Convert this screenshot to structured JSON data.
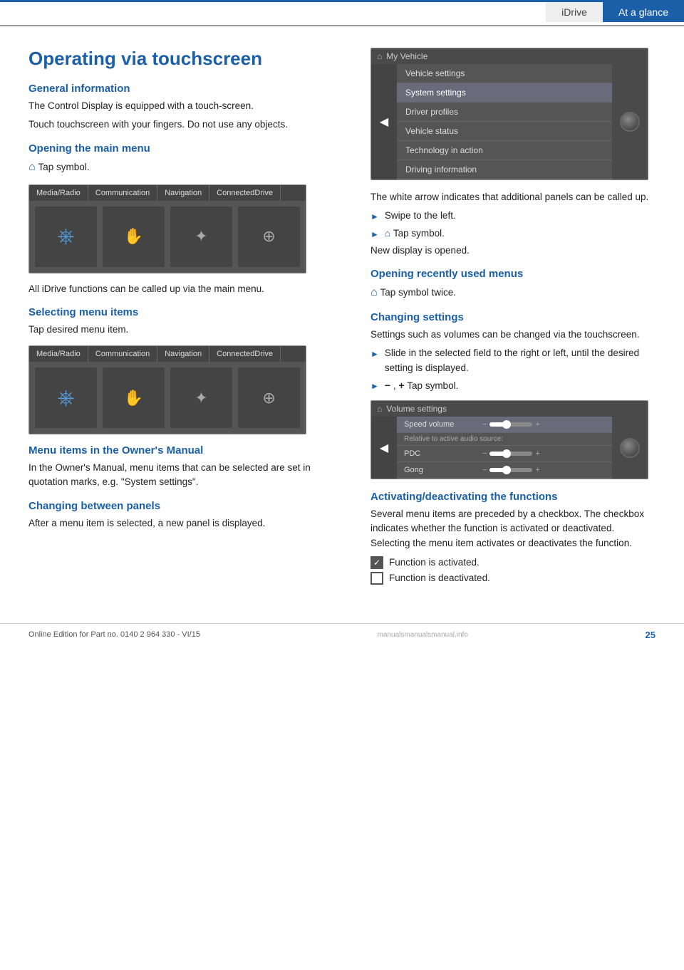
{
  "header": {
    "idrive_label": "iDrive",
    "tab_label": "At a glance"
  },
  "page": {
    "title": "Operating via touchscreen",
    "sections": {
      "general_info": {
        "heading": "General information",
        "para1": "The Control Display is equipped with a touch-screen.",
        "para2": "Touch touchscreen with your fingers. Do not use any objects."
      },
      "opening_main_menu": {
        "heading": "Opening the main menu",
        "text": "Tap symbol."
      },
      "screen1": {
        "menu_items": [
          "Media/Radio",
          "Communication",
          "Navigation",
          "ConnectedDrive"
        ]
      },
      "all_idrive": {
        "text": "All iDrive functions can be called up via the main menu."
      },
      "selecting_menu_items": {
        "heading": "Selecting menu items",
        "text": "Tap desired menu item."
      },
      "screen2": {
        "menu_items": [
          "Media/Radio",
          "Communication",
          "Navigation",
          "ConnectedDrive"
        ]
      },
      "menu_items_owners": {
        "heading": "Menu items in the Owner's Manual",
        "text": "In the Owner's Manual, menu items that can be selected are set in quotation marks, e.g. \"System settings\"."
      },
      "changing_panels": {
        "heading": "Changing between panels",
        "text": "After a menu item is selected, a new panel is displayed."
      }
    },
    "right_sections": {
      "vehicle_menu": {
        "top_label": "My Vehicle",
        "items": [
          {
            "label": "Vehicle settings",
            "highlighted": false
          },
          {
            "label": "System settings",
            "highlighted": true
          },
          {
            "label": "Driver profiles",
            "highlighted": false
          },
          {
            "label": "Vehicle status",
            "highlighted": false
          },
          {
            "label": "Technology in action",
            "highlighted": false
          },
          {
            "label": "Driving information",
            "highlighted": false
          }
        ]
      },
      "white_arrow_text": "The white arrow indicates that additional panels can be called up.",
      "bullet1": "Swipe to the left.",
      "bullet2": "Tap symbol.",
      "new_display": "New display is opened.",
      "opening_recently": {
        "heading": "Opening recently used menus",
        "text": "Tap symbol twice."
      },
      "changing_settings": {
        "heading": "Changing settings",
        "text": "Settings such as volumes can be changed via the touchscreen."
      },
      "bullet3": "Slide in the selected field to the right or left, until the desired setting is displayed.",
      "bullet4": "Tap symbol.",
      "volume_menu": {
        "top_label": "Volume settings",
        "rows": [
          {
            "label": "Speed volume",
            "type": "slider",
            "highlighted": true
          },
          {
            "label": "Relative to active audio source:",
            "type": "info"
          },
          {
            "label": "PDC",
            "type": "slider",
            "highlighted": false
          },
          {
            "label": "Gong",
            "type": "slider",
            "highlighted": false
          }
        ]
      },
      "activating": {
        "heading": "Activating/deactivating the functions",
        "text": "Several menu items are preceded by a checkbox. The checkbox indicates whether the function is activated or deactivated. Selecting the menu item activates or deactivates the function.",
        "checked_label": "Function is activated.",
        "unchecked_label": "Function is deactivated."
      }
    }
  },
  "footer": {
    "text": "Online Edition for Part no. 0140 2 964 330 - VI/15",
    "page_number": "25",
    "logo_text": "manualsmanualsmanual.info"
  }
}
